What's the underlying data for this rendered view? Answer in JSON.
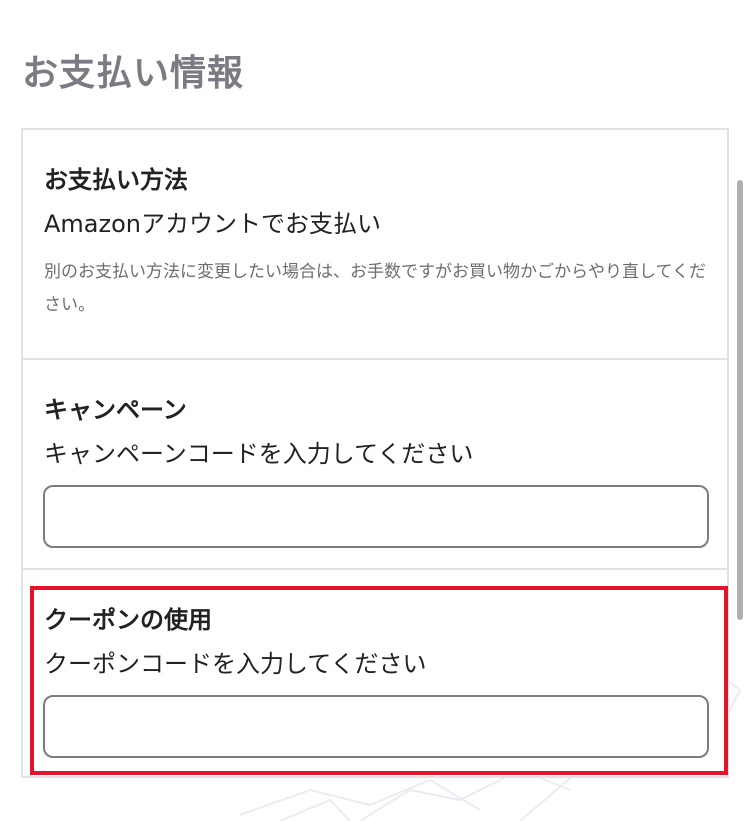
{
  "page": {
    "title": "お支払い情報"
  },
  "payment_method": {
    "title": "お支払い方法",
    "value": "Amazonアカウントでお支払い",
    "note": "別のお支払い方法に変更したい場合は、お手数ですがお買い物かごからやり直してください。"
  },
  "campaign": {
    "title": "キャンペーン",
    "prompt": "キャンペーンコードを入力してください",
    "input_value": ""
  },
  "coupon": {
    "title": "クーポンの使用",
    "prompt": "クーポンコードを入力してください",
    "input_value": ""
  },
  "colors": {
    "highlight": "#e2132a",
    "title_gray": "#7b7b84",
    "border": "#e2e2e2"
  }
}
